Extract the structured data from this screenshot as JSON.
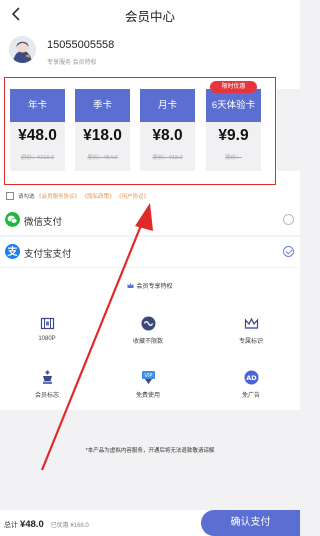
{
  "header": {
    "title": "会员中心"
  },
  "profile": {
    "phone": "15055005558",
    "privilege": "专享服务 会员特权"
  },
  "plans": [
    {
      "name": "年卡",
      "price": "¥48.0",
      "original": "原价：¥216.0",
      "badge": ""
    },
    {
      "name": "季卡",
      "price": "¥18.0",
      "original": "原价：¥54.0",
      "badge": ""
    },
    {
      "name": "月卡",
      "price": "¥8.0",
      "original": "原价：¥18.0",
      "badge": ""
    },
    {
      "name": "6天体验卡",
      "price": "¥9.9",
      "original": "原价：",
      "badge": "限时优惠"
    }
  ],
  "agreement": {
    "prefix": "请勾选",
    "links": [
      "《会员服务协议》",
      "《隐私政策》",
      "《用户协议》"
    ]
  },
  "payment": [
    {
      "label": "微信支付",
      "icon": "wechat-pay-icon",
      "selected": false,
      "color": "#21b73a"
    },
    {
      "label": "支付宝支付",
      "icon": "alipay-icon",
      "selected": true,
      "color": "#1a7ff0"
    }
  ],
  "features": {
    "title": "会员专享特权",
    "items": [
      {
        "label": "1080P",
        "icon": "hd-film-icon"
      },
      {
        "label": "收藏不限数",
        "icon": "infinity-icon"
      },
      {
        "label": "专属标识",
        "icon": "crown-icon"
      },
      {
        "label": "会员标志",
        "icon": "chess-king-icon"
      },
      {
        "label": "免费使用",
        "icon": "vip-gift-icon"
      },
      {
        "label": "免广告",
        "icon": "ad-block-icon"
      }
    ]
  },
  "notice": "*本产品为虚拟内容服务，开通后将无法退款敬请谅解",
  "footer": {
    "total_label": "总计",
    "total_amount": "¥48.0",
    "discount": "已优惠 ¥168.0",
    "confirm_label": "确认支付"
  },
  "colors": {
    "accent": "#5a6fd1",
    "highlight": "#e02a2a",
    "link": "#e8964a"
  }
}
